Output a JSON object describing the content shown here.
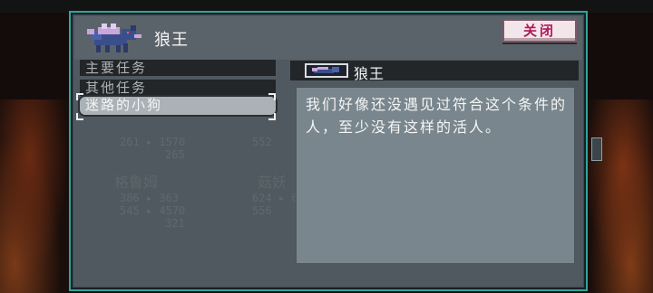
{
  "header": {
    "title": "狼王",
    "close_label": "关闭"
  },
  "quest_list": {
    "items": [
      {
        "label": "主要任务",
        "selected": false
      },
      {
        "label": "其他任务",
        "selected": false
      },
      {
        "label": "迷路的小狗",
        "selected": true
      }
    ]
  },
  "background_stats": {
    "row1": [
      "261 ▸ 1570",
      "552"
    ],
    "row2": [
      "265"
    ],
    "names": [
      "格鲁姆",
      "菇妖"
    ],
    "row3": [
      "386 ▸ 363",
      "624 ▸ 69"
    ],
    "row4": [
      "545 ▸ 4570",
      "556"
    ],
    "row5": [
      "321"
    ]
  },
  "detail": {
    "title": "狼王",
    "text": "我们好像还没遇见过符合这个条件的人，至少没有这样的活人。"
  },
  "colors": {
    "frame": "#2fa59c",
    "panel": "#50595f",
    "close_text": "#b0175a",
    "wolf_body": "#3a4f8a",
    "wolf_mane": "#c9a6dd"
  }
}
